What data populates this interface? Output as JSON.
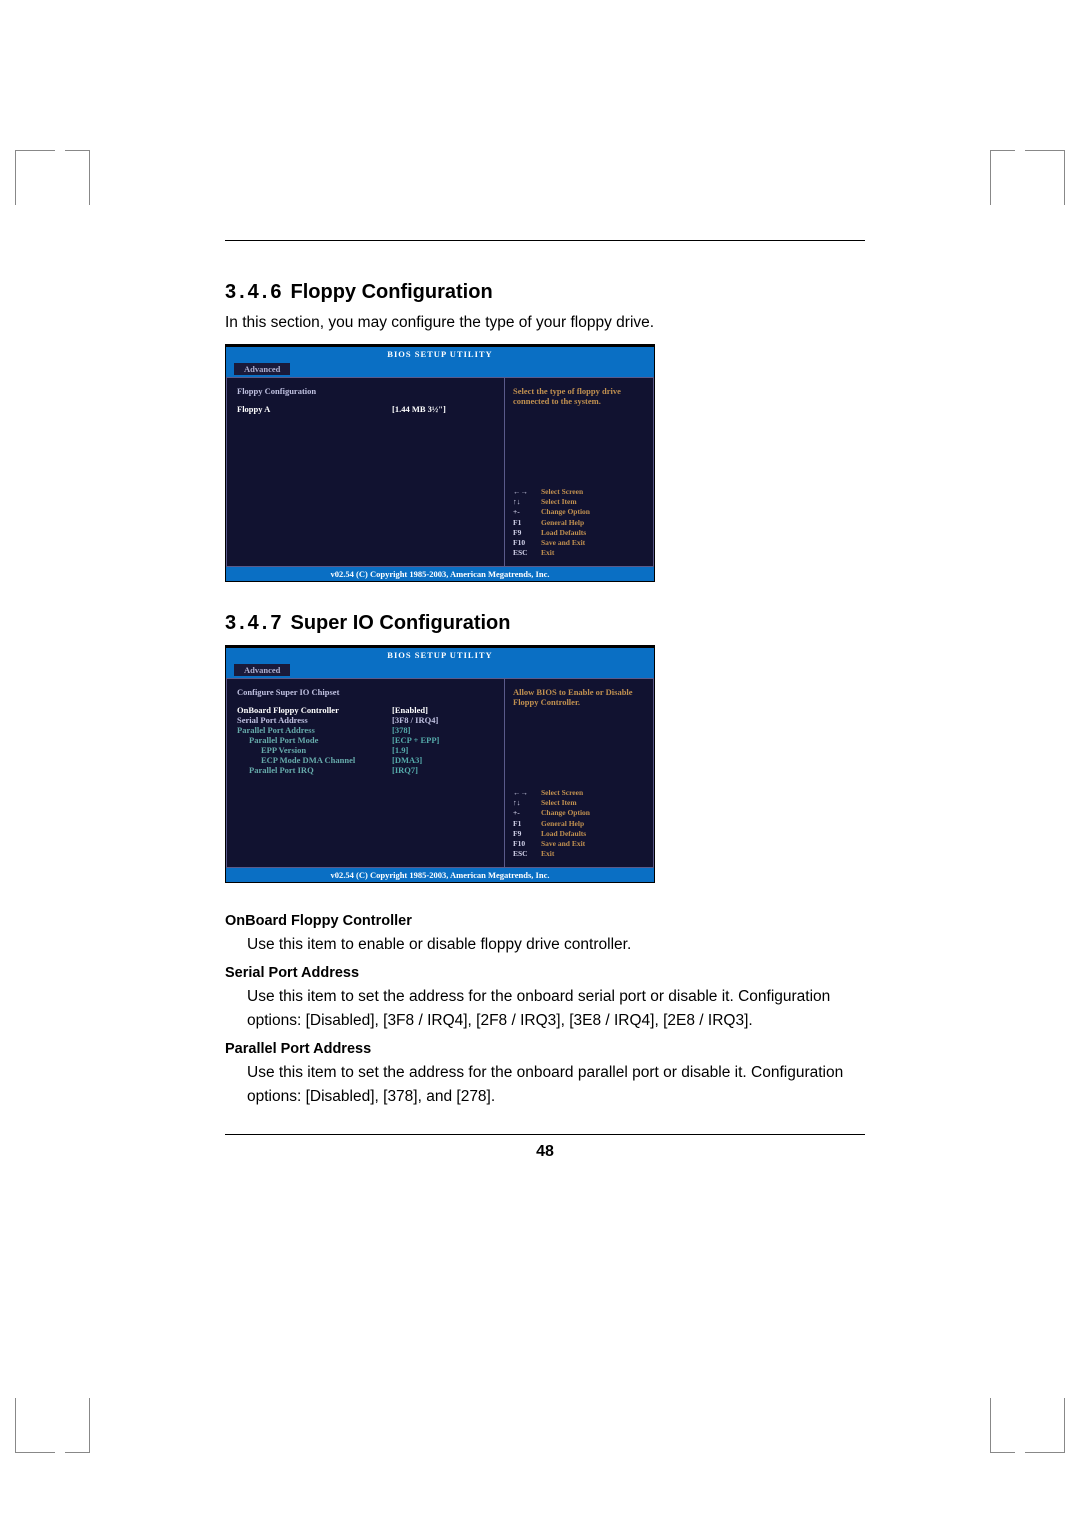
{
  "section1": {
    "number": "3.4.6",
    "title": "Floppy Configuration",
    "intro": "In this section, you may configure the type of your floppy drive."
  },
  "section2": {
    "number": "3.4.7",
    "title": "Super IO Configuration"
  },
  "bios_common": {
    "title": "BIOS SETUP UTILITY",
    "tab": "Advanced",
    "footer": "v02.54 (C) Copyright 1985-2003, American Megatrends, Inc.",
    "nav": {
      "k1": "←→",
      "v1": "Select Screen",
      "k2": "↑↓",
      "v2": "Select Item",
      "k3": "+-",
      "v3": "Change Option",
      "k4": "F1",
      "v4": "General Help",
      "k5": "F9",
      "v5": "Load Defaults",
      "k6": "F10",
      "v6": "Save and Exit",
      "k7": "ESC",
      "v7": "Exit"
    }
  },
  "bios1": {
    "section": "Floppy Configuration",
    "row_l": "Floppy A",
    "row_v": "[1.44 MB 3½\"]",
    "help": "Select the type of floppy drive connected to the system."
  },
  "bios2": {
    "section": "Configure Super IO Chipset",
    "help": "Allow BIOS to Enable or Disable Floppy Controller.",
    "rows": {
      "r0l": "OnBoard Floppy Controller",
      "r0v": "[Enabled]",
      "r1l": "Serial Port Address",
      "r1v": "[3F8 / IRQ4]",
      "r2l": "Parallel Port Address",
      "r2v": "[378]",
      "r3l": "Parallel Port Mode",
      "r3v": "[ECP + EPP]",
      "r4l": "EPP Version",
      "r4v": "[1.9]",
      "r5l": "ECP Mode DMA Channel",
      "r5v": "[DMA3]",
      "r6l": "Parallel Port IRQ",
      "r6v": "[IRQ7]"
    }
  },
  "desc": {
    "onboard_h": "OnBoard Floppy Controller",
    "onboard_p": "Use this item to enable or disable floppy drive controller.",
    "serial_h": "Serial Port Address",
    "serial_p": "Use this item to set the address for the onboard serial port or disable it. Configuration options: [Disabled], [3F8 / IRQ4], [2F8 / IRQ3], [3E8 / IRQ4], [2E8 / IRQ3].",
    "parallel_h": "Parallel Port Address",
    "parallel_p": "Use this item to set the address for the onboard parallel port or disable it. Configuration options: [Disabled], [378], and [278]."
  },
  "page_number": "48"
}
